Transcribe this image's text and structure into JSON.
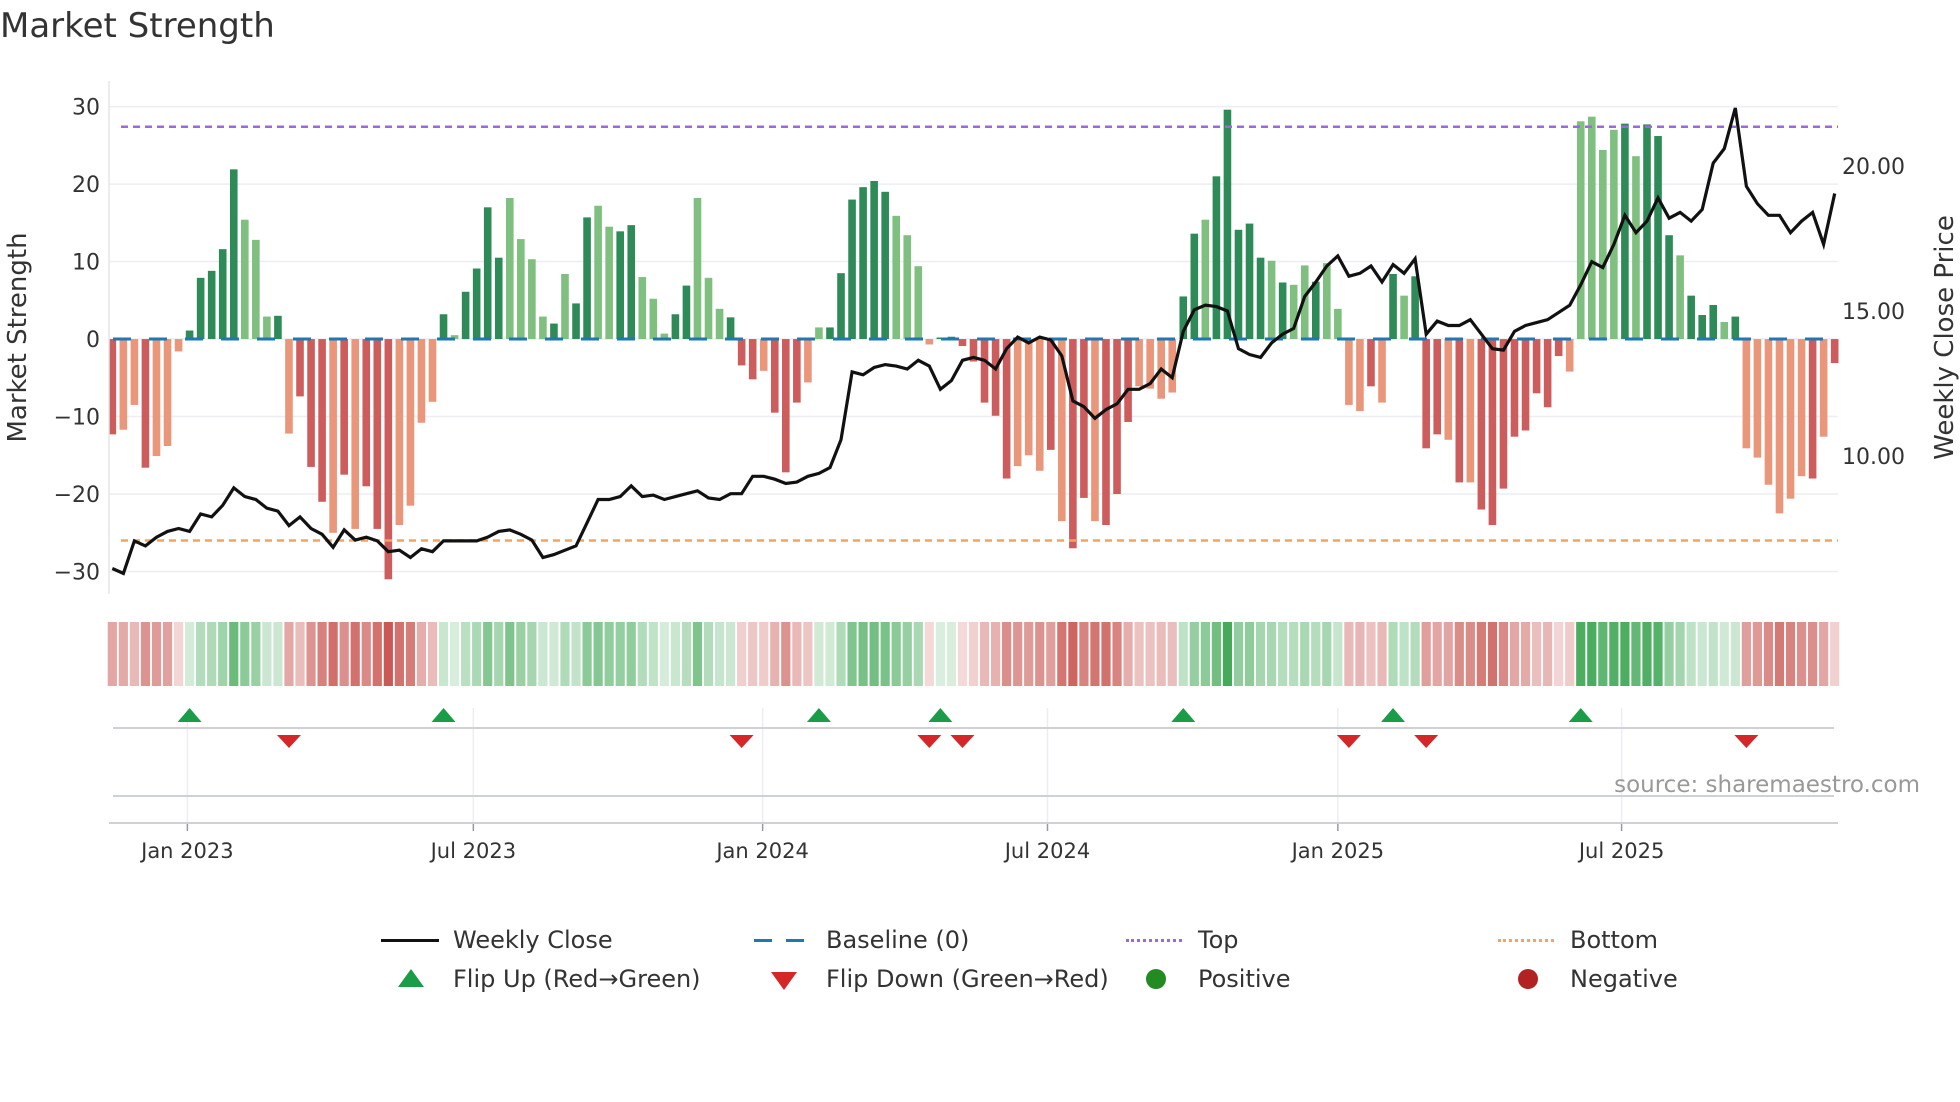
{
  "title": "Market Strength",
  "source": "source: sharemaestro.com",
  "colors": {
    "green_dark": "#2e8b57",
    "green_light": "#7fbf7f",
    "red_dark": "#cd5c5c",
    "red_light": "#e9967a",
    "baseline": "#1f77b4",
    "top": "#9b6ad6",
    "bottom": "#f4a460",
    "close": "#111111",
    "flip_up": "#1a9c48",
    "flip_down": "#d62728",
    "positive": "#228b22",
    "negative": "#b22222"
  },
  "legend": {
    "weekly_close": "Weekly Close",
    "baseline": "Baseline (0)",
    "top": "Top",
    "bottom": "Bottom",
    "flip_up": "Flip Up (Red→Green)",
    "flip_down": "Flip Down (Green→Red)",
    "positive": "Positive",
    "negative": "Negative"
  },
  "chart_data": {
    "type": "bar",
    "title": "Market Strength",
    "ylabel": "Market Strength",
    "y2label": "Weekly Close Price",
    "ylim": [
      -32.9,
      33.3
    ],
    "y2lim": [
      5.24,
      22.93
    ],
    "yticks": [
      -30,
      -20,
      -10,
      0,
      10,
      20,
      30
    ],
    "ytick_labels": [
      "−30",
      "−20",
      "−10",
      "0",
      "10",
      "20",
      "30"
    ],
    "y2ticks": [
      10,
      15,
      20
    ],
    "y2tick_labels": [
      "10.00",
      "15.00",
      "20.00"
    ],
    "xlim_weeks": [
      -0.3,
      156.3
    ],
    "xticks": [
      {
        "week": 6.8,
        "label": "Jan 2023"
      },
      {
        "week": 32.7,
        "label": "Jul 2023"
      },
      {
        "week": 58.9,
        "label": "Jan 2024"
      },
      {
        "week": 84.7,
        "label": "Jul 2024"
      },
      {
        "week": 111.0,
        "label": "Jan 2025"
      },
      {
        "week": 136.7,
        "label": "Jul 2025"
      }
    ],
    "top_level": 27.4,
    "bottom_level": -26.0,
    "baseline": 0,
    "strength": [
      -12.3,
      -11.7,
      -8.5,
      -16.6,
      -15.1,
      -13.8,
      -1.6,
      1.1,
      7.9,
      8.8,
      11.6,
      21.9,
      15.4,
      12.8,
      2.9,
      3.0,
      -12.2,
      -7.4,
      -16.5,
      -21,
      -25,
      -17.5,
      -24.5,
      -19,
      -24.5,
      -31,
      -24,
      -21.5,
      -10.8,
      -8.1,
      3.2,
      0.5,
      6.1,
      9.1,
      17.0,
      10.5,
      18.2,
      12.9,
      10.3,
      2.9,
      2.0,
      8.4,
      4.6,
      15.7,
      17.2,
      14.5,
      13.9,
      14.7,
      8.0,
      5.2,
      0.7,
      3.2,
      6.9,
      18.2,
      7.9,
      3.9,
      2.8,
      -3.4,
      -5.2,
      -4.1,
      -9.5,
      -17.2,
      -8.2,
      -5.6,
      1.5,
      1.5,
      8.5,
      18.0,
      19.6,
      20.4,
      19.0,
      15.9,
      13.4,
      9.4,
      -0.7,
      0.2,
      0.3,
      -0.9,
      -2.9,
      -8.2,
      -9.9,
      -18.0,
      -16.4,
      -15.0,
      -17.0,
      -14.3,
      -23.5,
      -27.0,
      -20.5,
      -23.5,
      -24.0,
      -20.0,
      -10.7,
      -6.1,
      -6.4,
      -7.7,
      -6.9,
      5.5,
      13.6,
      15.4,
      21.0,
      29.6,
      14.1,
      14.9,
      10.5,
      10.1,
      7.3,
      7.0,
      9.5,
      7.4,
      9.8,
      3.9,
      -8.5,
      -9.3,
      -6.1,
      -8.2,
      8.4,
      5.6,
      8.1,
      -14.1,
      -12.3,
      -13.0,
      -18.5,
      -18.5,
      -22.0,
      -24.0,
      -19.3,
      -12.6,
      -11.8,
      -7.0,
      -8.8,
      -2.2,
      -4.2,
      28.1,
      28.7,
      24.4,
      27.0,
      27.8,
      23.6,
      27.7,
      26.2,
      13.4,
      10.8,
      5.6,
      3.1,
      4.4,
      2.2,
      2.9,
      -14.1,
      -15.3,
      -18.8,
      -22.5,
      -20.6,
      -17.7,
      -18.0,
      -12.6,
      -3.1
    ],
    "shade": "dlldllldddddllldldddldldddlllldlddddlllldlddllddlllddllldddldddllddddddlllldddddddllldlddldddllllddldddddldlldlllldldldddldlddddddddllllldldddldddldlllllldldddddlldll",
    "weekly_close": [
      6.12,
      5.95,
      7.07,
      6.9,
      7.2,
      7.4,
      7.5,
      7.4,
      8.0,
      7.9,
      8.3,
      8.9,
      8.6,
      8.5,
      8.2,
      8.1,
      7.6,
      7.9,
      7.5,
      7.3,
      6.85,
      7.45,
      7.1,
      7.2,
      7.07,
      6.7,
      6.75,
      6.5,
      6.8,
      6.7,
      7.07,
      7.07,
      7.07,
      7.07,
      7.2,
      7.4,
      7.45,
      7.3,
      7.1,
      6.5,
      6.6,
      6.75,
      6.9,
      7.7,
      8.5,
      8.5,
      8.6,
      8.97,
      8.6,
      8.65,
      8.5,
      8.6,
      8.7,
      8.8,
      8.55,
      8.5,
      8.7,
      8.7,
      9.3,
      9.3,
      9.2,
      9.05,
      9.1,
      9.3,
      9.4,
      9.6,
      10.56,
      12.9,
      12.8,
      13.05,
      13.15,
      13.1,
      13.0,
      13.3,
      13.1,
      12.3,
      12.6,
      13.3,
      13.4,
      13.3,
      13.0,
      13.7,
      14.1,
      13.9,
      14.1,
      14.0,
      13.45,
      11.9,
      11.7,
      11.3,
      11.6,
      11.8,
      12.3,
      12.3,
      12.5,
      13.0,
      12.7,
      14.3,
      15.04,
      15.2,
      15.15,
      15.0,
      13.7,
      13.5,
      13.4,
      13.9,
      14.2,
      14.4,
      15.5,
      16.0,
      16.55,
      16.9,
      16.2,
      16.3,
      16.55,
      16.0,
      16.6,
      16.3,
      16.8,
      14.2,
      14.65,
      14.5,
      14.5,
      14.7,
      14.2,
      13.7,
      13.65,
      14.3,
      14.5,
      14.6,
      14.7,
      14.95,
      15.2,
      15.9,
      16.7,
      16.5,
      17.3,
      18.3,
      17.7,
      18.1,
      18.9,
      18.2,
      18.4,
      18.1,
      18.5,
      20.1,
      20.6,
      22.0,
      19.3,
      18.7,
      18.3,
      18.3,
      17.7,
      18.1,
      18.4,
      17.3,
      19.05
    ],
    "flip_up_weeks": [
      7,
      30,
      64,
      75,
      97,
      116,
      133
    ],
    "flip_down_weeks": [
      16,
      57,
      74,
      77,
      112,
      119,
      148
    ],
    "legend_placement": "bottom-center"
  }
}
